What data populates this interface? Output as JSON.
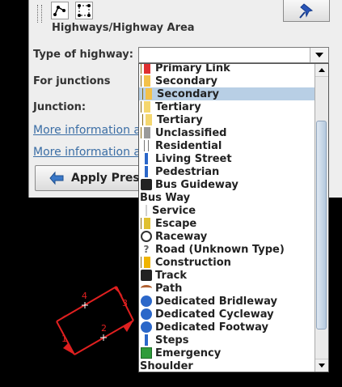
{
  "panel": {
    "heading": "Highways/Highway Area",
    "type_label": "Type of highway:",
    "junctions_label": "For junctions",
    "junction_label": "Junction:",
    "more_info_1": "More information about",
    "more_info_2": "More information about",
    "apply_label": "Apply Preset",
    "combo_value": ""
  },
  "dropdown": {
    "items": [
      {
        "label": "Primary Link",
        "icon": "primary-link-icon",
        "color": "#e03030"
      },
      {
        "label": "Secondary",
        "icon": "secondary-road-icon",
        "color": "#f3c14a"
      },
      {
        "label": "Secondary",
        "icon": "secondary-link-icon",
        "color": "#f3c14a",
        "selected": true
      },
      {
        "label": "Tertiary",
        "icon": "tertiary-road-icon",
        "color": "#f5d76e"
      },
      {
        "label": "Tertiary",
        "icon": "tertiary-link-icon",
        "color": "#f5d76e"
      },
      {
        "label": "Unclassified",
        "icon": "unclassified-road-icon",
        "color": "#9a9a9a"
      },
      {
        "label": "Residential",
        "icon": "residential-road-icon",
        "color": "#ffffff"
      },
      {
        "label": "Living Street",
        "icon": "living-street-icon",
        "color": "#2b67c9"
      },
      {
        "label": "Pedestrian",
        "icon": "pedestrian-icon",
        "color": "#2b67c9"
      },
      {
        "label": "Bus Guideway",
        "icon": "bus-icon",
        "color": "#222222"
      },
      {
        "label": "Bus Way",
        "icon": "",
        "color": ""
      },
      {
        "label": "Service",
        "icon": "service-road-icon",
        "color": "#cfcfcf"
      },
      {
        "label": "Escape",
        "icon": "escape-lane-icon",
        "color": "#e0c030"
      },
      {
        "label": "Raceway",
        "icon": "raceway-icon",
        "color": "#333333"
      },
      {
        "label": "Road (Unknown Type)",
        "icon": "unknown-road-icon",
        "color": "#666666"
      },
      {
        "label": "Construction",
        "icon": "construction-icon",
        "color": "#f0b400"
      },
      {
        "label": "Track",
        "icon": "tractor-icon",
        "color": "#222222"
      },
      {
        "label": "Path",
        "icon": "path-icon",
        "color": "#b06030"
      },
      {
        "label": "Dedicated Bridleway",
        "icon": "bridleway-icon",
        "color": "#2b67c9"
      },
      {
        "label": "Dedicated Cycleway",
        "icon": "cycleway-icon",
        "color": "#2b67c9"
      },
      {
        "label": "Dedicated Footway",
        "icon": "footway-icon",
        "color": "#2b67c9"
      },
      {
        "label": "Steps",
        "icon": "steps-icon",
        "color": "#2b67c9"
      },
      {
        "label": "Emergency",
        "icon": "emergency-icon",
        "color": "#2e9b3a"
      },
      {
        "label": "Shoulder",
        "icon": "",
        "color": ""
      }
    ]
  },
  "map": {
    "nodes": [
      "1",
      "2",
      "3",
      "4"
    ],
    "color": "#e02020"
  },
  "colors": {
    "selected": "#b8cfe5",
    "link": "#3b6ea5",
    "panel": "#eeeeee"
  }
}
